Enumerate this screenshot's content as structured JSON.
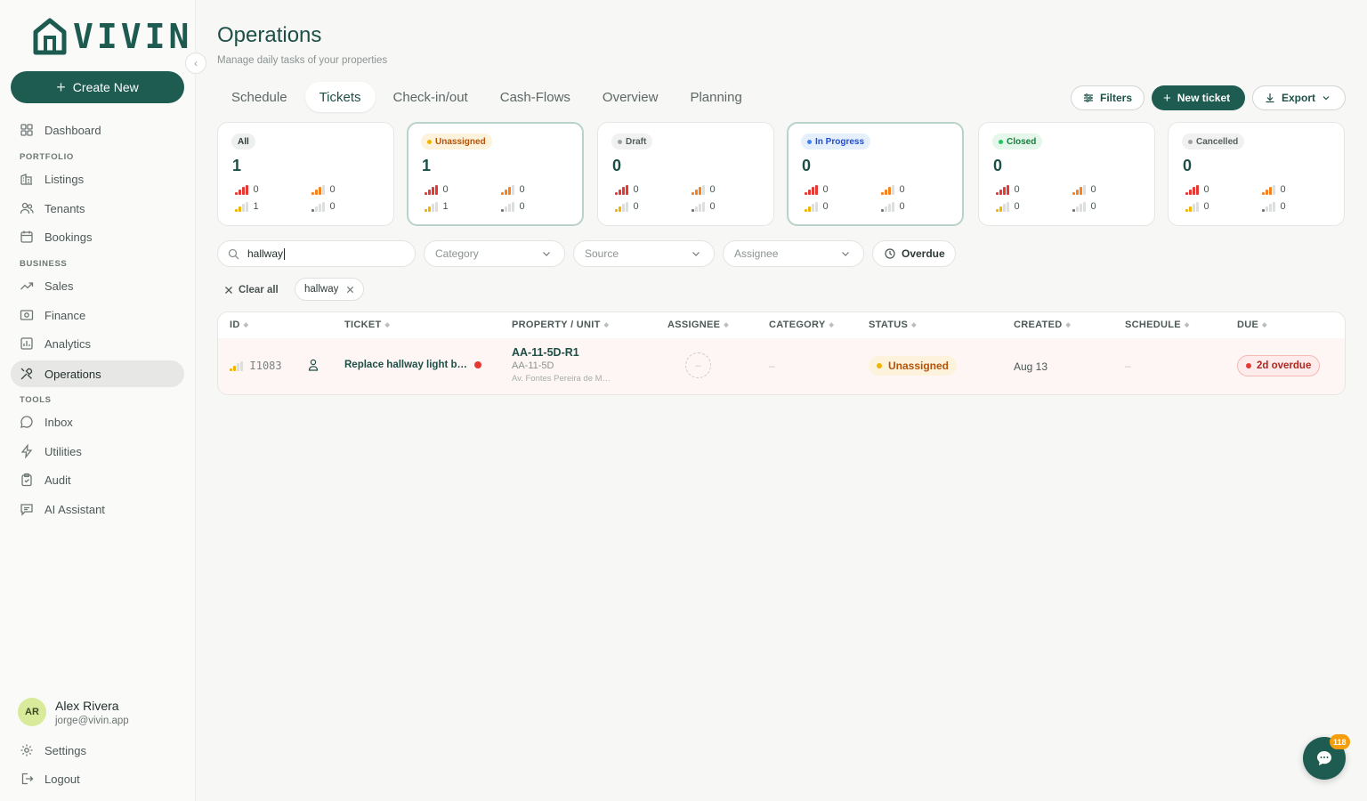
{
  "brand": {
    "name": "VIVIN",
    "accent": "#1e5b50"
  },
  "sidebar": {
    "create_label": "Create New",
    "dashboard": "Dashboard",
    "sections": {
      "portfolio": "PORTFOLIO",
      "business": "BUSINESS",
      "tools": "TOOLS"
    },
    "portfolio_items": [
      "Listings",
      "Tenants",
      "Bookings"
    ],
    "business_items": [
      "Sales",
      "Finance",
      "Analytics",
      "Operations"
    ],
    "tools_items": [
      "Inbox",
      "Utilities",
      "Audit",
      "AI Assistant"
    ],
    "active_item": "Operations",
    "user": {
      "initials": "AR",
      "name": "Alex Rivera",
      "email": "jorge@vivin.app"
    },
    "settings": "Settings",
    "logout": "Logout"
  },
  "header": {
    "title": "Operations",
    "subtitle": "Manage daily tasks of your properties"
  },
  "tabs": [
    "Schedule",
    "Tickets",
    "Check-in/out",
    "Cash-Flows",
    "Overview",
    "Planning"
  ],
  "active_tab": "Tickets",
  "toolbar": {
    "filters": "Filters",
    "new_ticket": "New ticket",
    "export": "Export"
  },
  "status_cards": [
    {
      "label": "All",
      "count": "1",
      "badge_bg": "#eef0ef",
      "badge_fg": "#2f3b39",
      "dot": "",
      "urgent": "0",
      "high": "0",
      "medium": "1",
      "low": "0",
      "highlight": false
    },
    {
      "label": "Unassigned",
      "count": "1",
      "badge_bg": "#fdf3dc",
      "badge_fg": "#b45309",
      "dot": "#f0b400",
      "urgent": "0",
      "high": "0",
      "medium": "1",
      "low": "0",
      "highlight": true
    },
    {
      "label": "Draft",
      "count": "0",
      "badge_bg": "#f0f1f0",
      "badge_fg": "#55605e",
      "dot": "#9aa3a1",
      "urgent": "0",
      "high": "0",
      "medium": "0",
      "low": "0",
      "highlight": false
    },
    {
      "label": "In Progress",
      "count": "0",
      "badge_bg": "#e6effc",
      "badge_fg": "#1d4ed8",
      "dot": "#3b82f6",
      "urgent": "0",
      "high": "0",
      "medium": "0",
      "low": "0",
      "highlight": true
    },
    {
      "label": "Closed",
      "count": "0",
      "badge_bg": "#e5f6ea",
      "badge_fg": "#15803d",
      "dot": "#22c55e",
      "urgent": "0",
      "high": "0",
      "medium": "0",
      "low": "0",
      "highlight": false
    },
    {
      "label": "Cancelled",
      "count": "0",
      "badge_bg": "#f0f1f0",
      "badge_fg": "#55605e",
      "dot": "#9aa3a1",
      "urgent": "0",
      "high": "0",
      "medium": "0",
      "low": "0",
      "highlight": false
    }
  ],
  "filters": {
    "search_value": "hallway",
    "category": "Category",
    "source": "Source",
    "assignee": "Assignee",
    "overdue": "Overdue",
    "clear_all": "Clear all",
    "active_chip": "hallway"
  },
  "table": {
    "columns": [
      "ID",
      "TICKET",
      "PROPERTY / UNIT",
      "ASSIGNEE",
      "CATEGORY",
      "STATUS",
      "CREATED",
      "SCHEDULE",
      "DUE"
    ],
    "rows": [
      {
        "id": "I1083",
        "ticket": "Replace hallway light b…",
        "property": "AA-11-5D-R1",
        "unit": "AA-11-5D",
        "address": "Av. Fontes Pereira de M…",
        "assignee": "–",
        "category": "–",
        "status": "Unassigned",
        "created": "Aug 13",
        "schedule": "–",
        "due": "2d overdue"
      }
    ]
  },
  "chat": {
    "badge": "118"
  }
}
